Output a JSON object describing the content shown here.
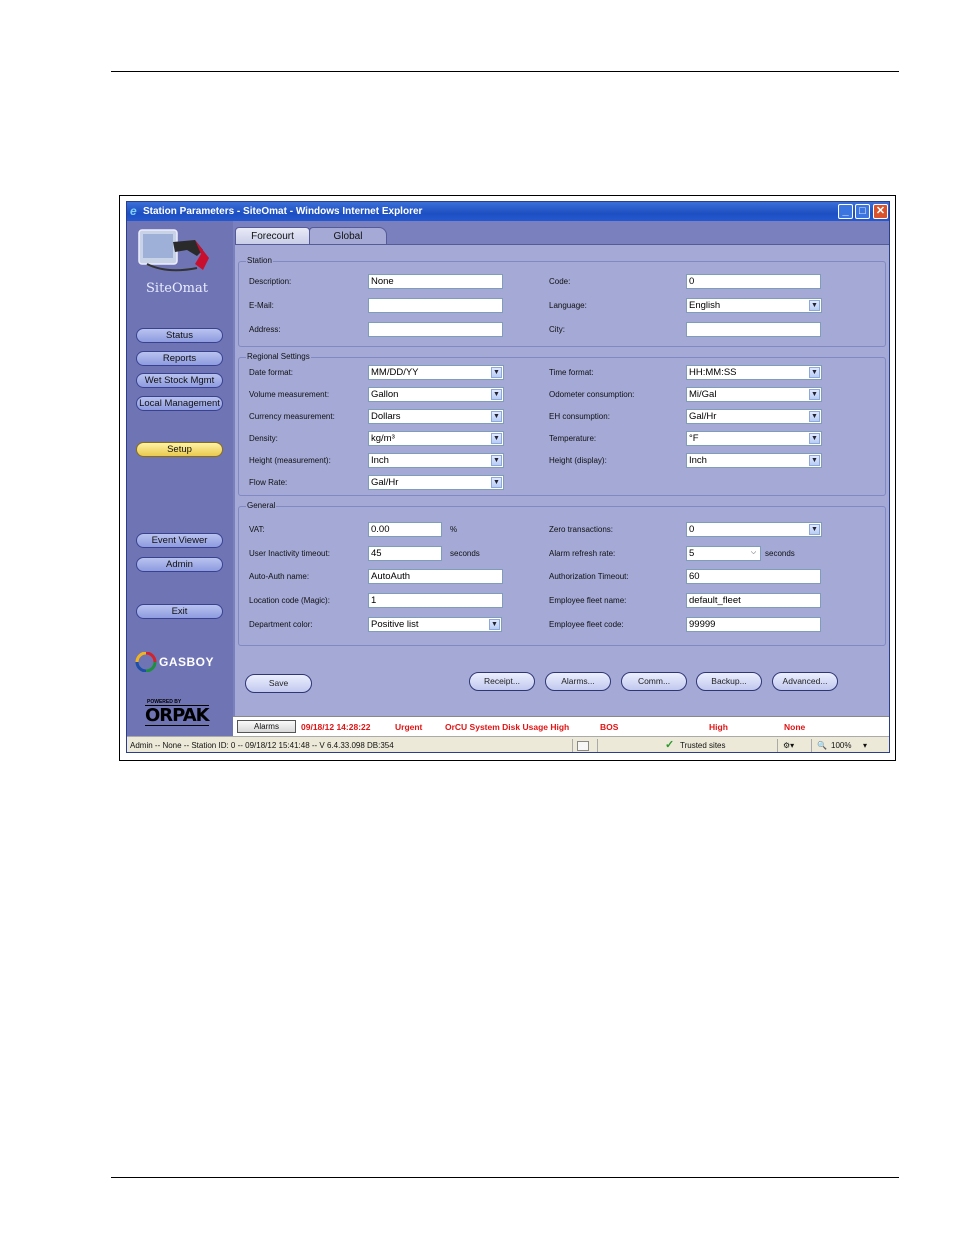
{
  "window": {
    "title": "Station Parameters - SiteOmat - Windows Internet Explorer"
  },
  "sidebar": {
    "brand": "SiteOmat",
    "items": [
      {
        "label": "Status"
      },
      {
        "label": "Reports"
      },
      {
        "label": "Wet Stock Mgmt"
      },
      {
        "label": "Local Management"
      },
      {
        "label": "Setup"
      },
      {
        "label": "Event Viewer"
      },
      {
        "label": "Admin"
      },
      {
        "label": "Exit"
      }
    ],
    "gasboy": "GASBOY",
    "powered_by": "POWERED BY",
    "orpak": "ORPAK"
  },
  "tabs": [
    {
      "label": "Forecourt"
    },
    {
      "label": "Global"
    }
  ],
  "station": {
    "legend": "Station",
    "description": {
      "label": "Description:",
      "value": "None"
    },
    "code": {
      "label": "Code:",
      "value": "0"
    },
    "email": {
      "label": "E-Mail:",
      "value": ""
    },
    "language": {
      "label": "Language:",
      "value": "English"
    },
    "address": {
      "label": "Address:",
      "value": ""
    },
    "city": {
      "label": "City:",
      "value": ""
    }
  },
  "regional": {
    "legend": "Regional Settings",
    "date_format": {
      "label": "Date format:",
      "value": "MM/DD/YY"
    },
    "time_format": {
      "label": "Time format:",
      "value": "HH:MM:SS"
    },
    "volume": {
      "label": "Volume measurement:",
      "value": "Gallon"
    },
    "odometer": {
      "label": "Odometer consumption:",
      "value": "Mi/Gal"
    },
    "currency": {
      "label": "Currency measurement:",
      "value": "Dollars"
    },
    "eh": {
      "label": "EH consumption:",
      "value": "Gal/Hr"
    },
    "density": {
      "label": "Density:",
      "value": "kg/m³"
    },
    "temperature": {
      "label": "Temperature:",
      "value": "°F"
    },
    "height_meas": {
      "label": "Height (measurement):",
      "value": "Inch"
    },
    "height_disp": {
      "label": "Height (display):",
      "value": "Inch"
    },
    "flow_rate": {
      "label": "Flow Rate:",
      "value": "Gal/Hr"
    }
  },
  "general": {
    "legend": "General",
    "vat": {
      "label": "VAT:",
      "value": "0.00",
      "unit": "%"
    },
    "zero_tx": {
      "label": "Zero transactions:",
      "value": "0"
    },
    "inactivity": {
      "label": "User Inactivity timeout:",
      "value": "45",
      "unit": "seconds"
    },
    "alarm_refresh": {
      "label": "Alarm refresh rate:",
      "value": "5",
      "unit": "seconds"
    },
    "auto_auth": {
      "label": "Auto-Auth name:",
      "value": "AutoAuth"
    },
    "auth_timeout": {
      "label": "Authorization Timeout:",
      "value": "60"
    },
    "location_code": {
      "label": "Location code (Magic):",
      "value": "1"
    },
    "fleet_name": {
      "label": "Employee fleet name:",
      "value": "default_fleet"
    },
    "dept_color": {
      "label": "Department color:",
      "value": "Positive list"
    },
    "fleet_code": {
      "label": "Employee fleet code:",
      "value": "99999"
    }
  },
  "actions": {
    "save": "Save",
    "receipt": "Receipt...",
    "alarms": "Alarms...",
    "comm": "Comm...",
    "backup": "Backup...",
    "advanced": "Advanced..."
  },
  "alarm_bar": {
    "button": "Alarms",
    "datetime": "09/18/12 14:28:22",
    "severity": "Urgent",
    "message": "OrCU System Disk Usage High",
    "device": "BOS",
    "level": "High",
    "ack": "None"
  },
  "statusbar": {
    "text": "Admin -- None -- Station ID: 0 -- 09/18/12 15:41:48 -- V 6.4.33.098 DB:354",
    "zone": "Trusted sites",
    "zoom": "100%"
  },
  "colors": {
    "window_bg": "#6f74b4",
    "panel_bg": "#a4a9d6",
    "alarm_text": "#e01414",
    "setup_active": "#e9c94e"
  }
}
